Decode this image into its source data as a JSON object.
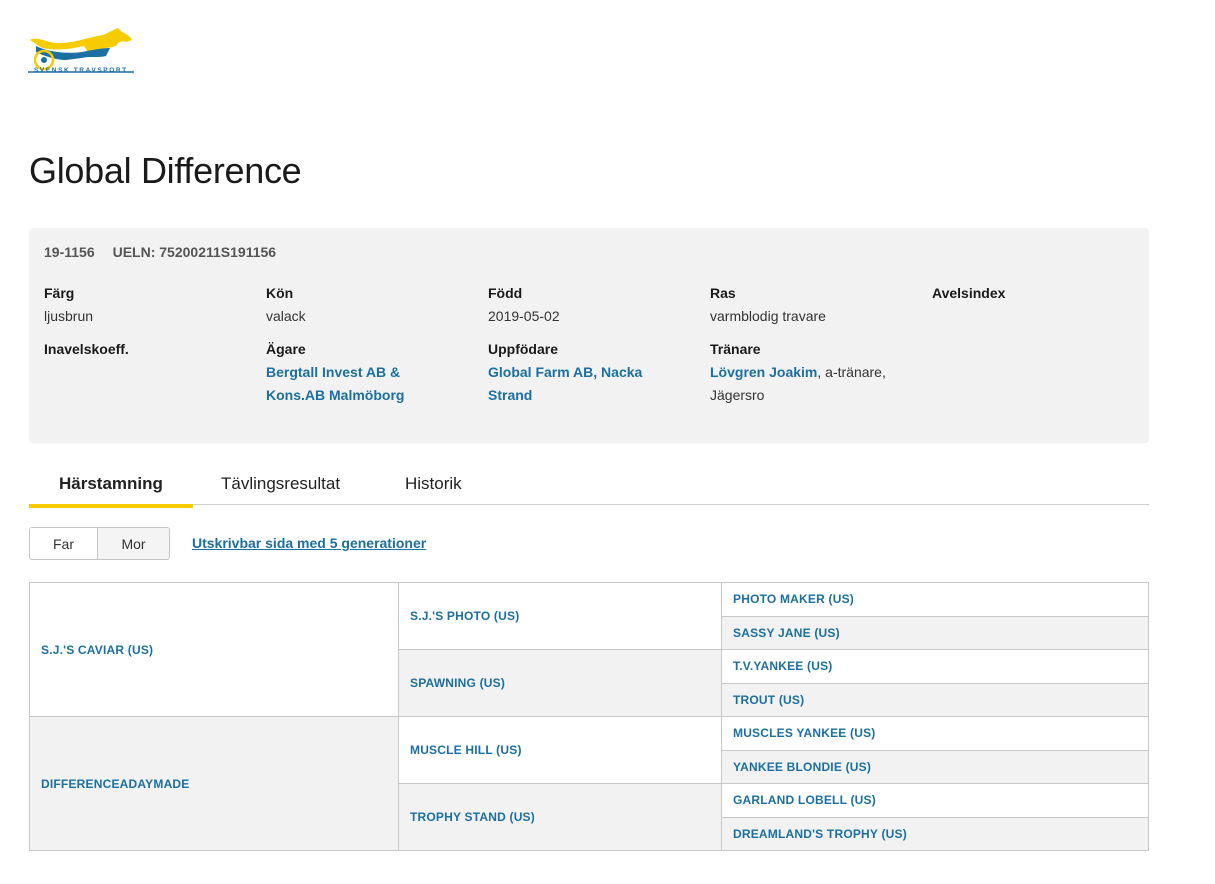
{
  "brand": {
    "logo_text": "SVENSK TRAVSPORT",
    "colors": {
      "yellow": "#f6cc00",
      "blue": "#1b6fa1"
    }
  },
  "horse": {
    "name": "Global Difference",
    "reg_no": "19-1156",
    "ueln": "UELN: 75200211S191156"
  },
  "info": {
    "farg": {
      "label": "Färg",
      "value": "ljusbrun"
    },
    "kon": {
      "label": "Kön",
      "value": "valack"
    },
    "fodd": {
      "label": "Född",
      "value": "2019-05-02"
    },
    "ras": {
      "label": "Ras",
      "value": "varmblodig travare"
    },
    "avelsindex": {
      "label": "Avelsindex",
      "value": ""
    },
    "inavel": {
      "label": "Inavelskoeff.",
      "value": ""
    },
    "agare": {
      "label": "Ägare",
      "line1": "Bergtall Invest AB &",
      "line2": "Kons.AB Malmöborg"
    },
    "uppfodare": {
      "label": "Uppfödare",
      "line1": "Global Farm AB, Nacka",
      "line2": "Strand"
    },
    "tranare": {
      "label": "Tränare",
      "name": "Lövgren Joakim",
      "suffix": ", a-tränare,",
      "line2": "Jägersro"
    }
  },
  "tabs": [
    {
      "label": "Härstamning",
      "active": true
    },
    {
      "label": "Tävlingsresultat",
      "active": false
    },
    {
      "label": "Historik",
      "active": false
    }
  ],
  "toggle": {
    "far": "Far",
    "mor": "Mor"
  },
  "print_link": "Utskrivbar sida med 5 generationer",
  "pedigree": {
    "gen1": [
      "S.J.'S CAVIAR (US)",
      "DIFFERENCEADAYMADE"
    ],
    "gen2": [
      "S.J.'S PHOTO (US)",
      "SPAWNING (US)",
      "MUSCLE HILL (US)",
      "TROPHY STAND (US)"
    ],
    "gen3": [
      "PHOTO MAKER (US)",
      "SASSY JANE (US)",
      "T.V.YANKEE (US)",
      "TROUT (US)",
      "MUSCLES YANKEE (US)",
      "YANKEE BLONDIE (US)",
      "GARLAND LOBELL (US)",
      "DREAMLAND'S TROPHY (US)"
    ]
  }
}
